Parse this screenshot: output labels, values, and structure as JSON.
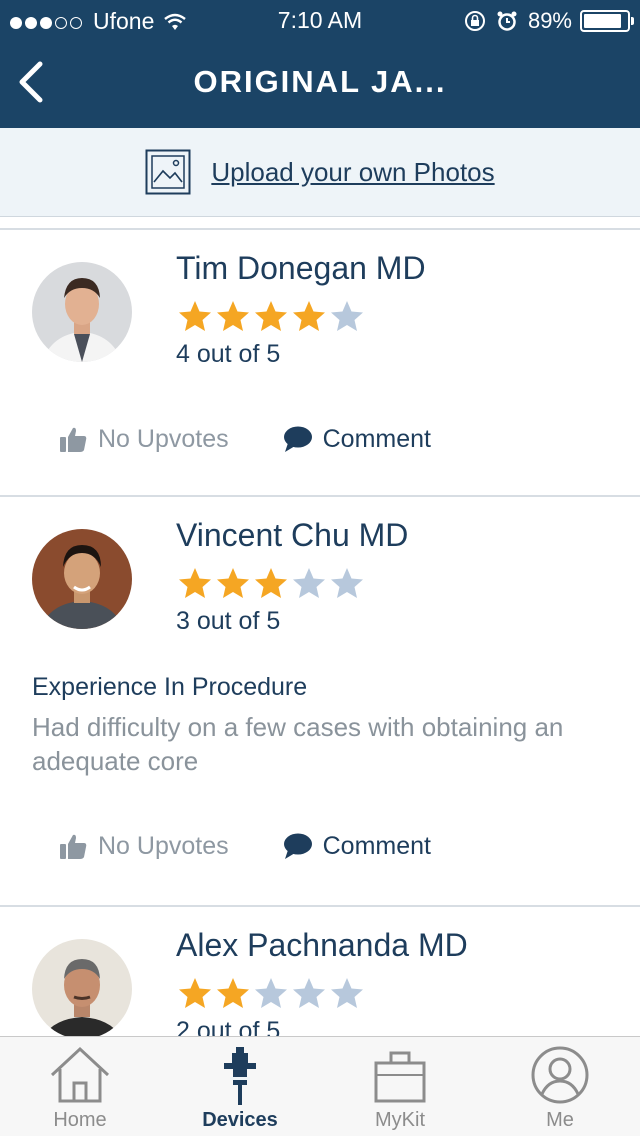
{
  "status_bar": {
    "carrier": "Ufone",
    "time": "7:10 AM",
    "battery": "89%",
    "battery_level": 0.89
  },
  "header": {
    "title": "ORIGINAL JA..."
  },
  "upload": {
    "label": "Upload your own Photos"
  },
  "reviews": [
    {
      "name": "Tim Donegan MD",
      "rating": 4,
      "score_text": "4 out of 5",
      "upvotes": "No Upvotes",
      "comment": "Comment"
    },
    {
      "name": "Vincent Chu MD",
      "rating": 3,
      "score_text": "3 out of 5",
      "review_title": "Experience In Procedure",
      "review_text": "Had difficulty on a few cases with obtaining an adequate core",
      "upvotes": "No Upvotes",
      "comment": "Comment"
    },
    {
      "name": "Alex Pachnanda MD",
      "rating": 2,
      "score_text": "2 out of 5"
    }
  ],
  "tabs": [
    {
      "label": "Home",
      "icon": "home-icon"
    },
    {
      "label": "Devices",
      "icon": "devices-icon"
    },
    {
      "label": "MyKit",
      "icon": "mykit-icon"
    },
    {
      "label": "Me",
      "icon": "user-icon"
    }
  ],
  "colors": {
    "header": "#1b4466",
    "star_on": "#f5a623",
    "star_off": "#b7c8dc",
    "text": "#1e3d5c"
  }
}
